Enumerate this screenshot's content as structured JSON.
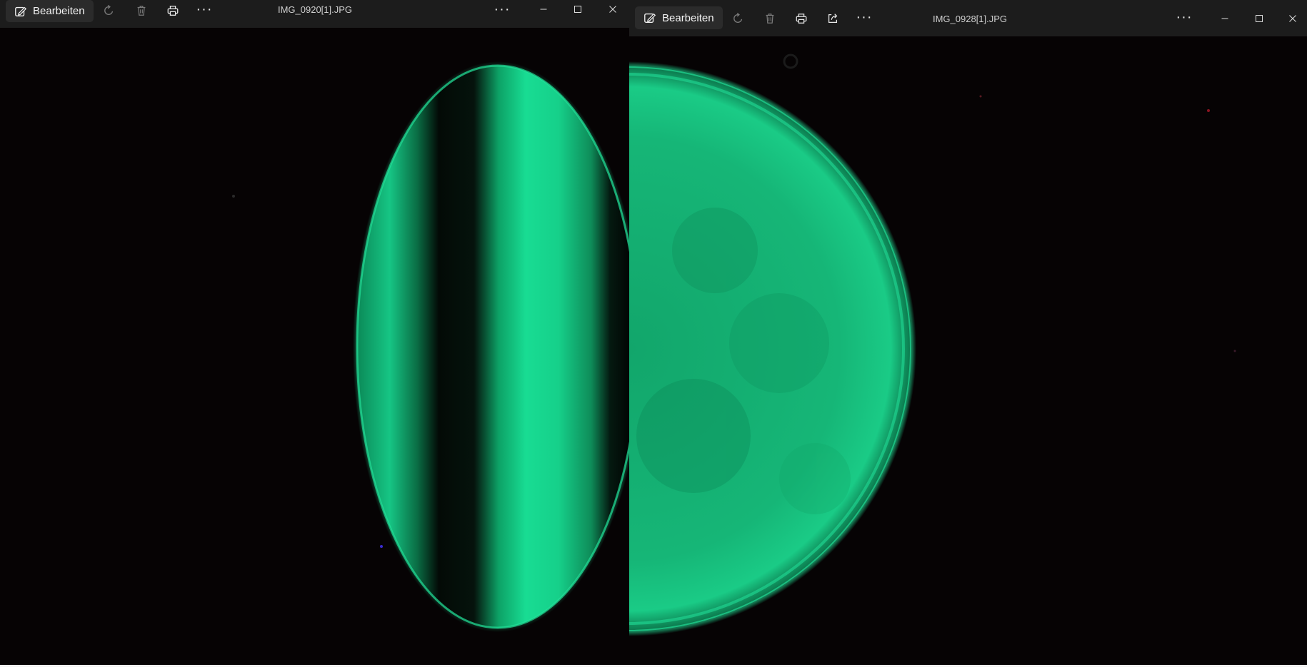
{
  "colors": {
    "titlebar": "#1c1c1c",
    "background": "#050304",
    "glow": "#1fd68f",
    "glow_dim": "#0e7f52"
  },
  "left_window": {
    "edit_label": "Bearbeiten",
    "filename": "IMG_0920[1].JPG",
    "toolbar_icons": [
      "edit-icon",
      "rotate-icon",
      "delete-icon",
      "print-icon",
      "more-icon"
    ],
    "window_controls": [
      "minimize-icon",
      "maximize-icon",
      "close-icon"
    ]
  },
  "right_window": {
    "edit_label": "Bearbeiten",
    "filename": "IMG_0928[1].JPG",
    "toolbar_icons": [
      "edit-icon",
      "rotate-icon",
      "delete-icon",
      "print-icon",
      "share-icon",
      "more-icon"
    ],
    "window_controls": [
      "minimize-icon",
      "maximize-icon",
      "close-icon"
    ]
  }
}
